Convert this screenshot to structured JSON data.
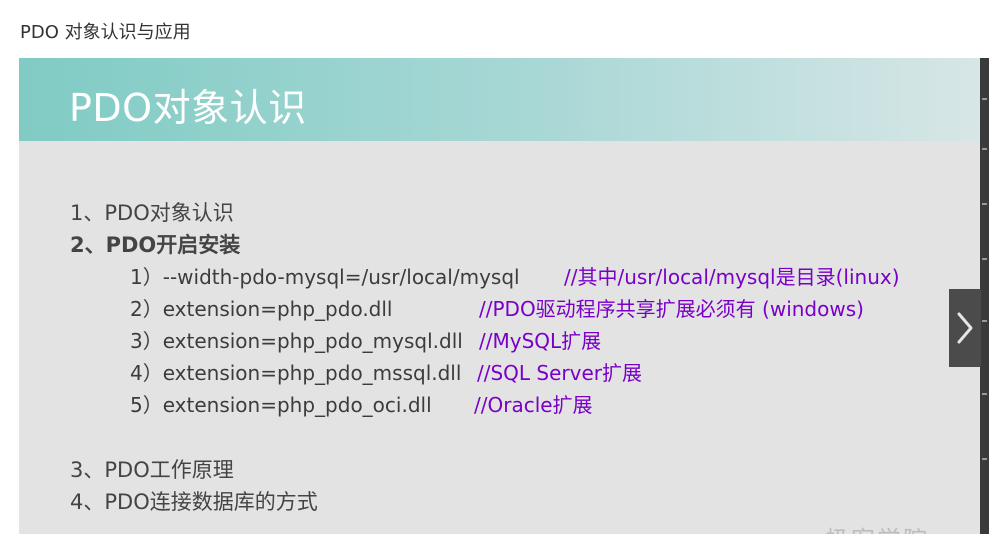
{
  "page": {
    "heading": "PDO 对象认识与应用"
  },
  "slide": {
    "title": "PDO对象认识",
    "items": [
      {
        "label": "1、PDO对象认识"
      },
      {
        "label": "2、PDO开启安装"
      },
      {
        "label": "3、PDO工作原理"
      },
      {
        "label": "4、PDO连接数据库的方式"
      }
    ],
    "sub_items": [
      {
        "code": "1）--width-pdo-mysql=/usr/local/mysql",
        "comment": "//其中/usr/local/mysql是目录(linux)"
      },
      {
        "code": "2）extension=php_pdo.dll",
        "comment": "//PDO驱动程序共享扩展必须有 (windows)"
      },
      {
        "code": "3）extension=php_pdo_mysql.dll",
        "comment": "//MySQL扩展"
      },
      {
        "code": "4）extension=php_pdo_mssql.dll",
        "comment": "//SQL Server扩展"
      },
      {
        "code": "5）extension=php_pdo_oci.dll",
        "comment": "//Oracle扩展"
      }
    ],
    "watermark": "极客学院"
  },
  "controls": {
    "next_icon": "chevron-right-icon"
  },
  "colors": {
    "banner_start": "#80cbc4",
    "banner_end": "#d7e6e6",
    "comment": "#7a00c8",
    "slide_bg": "#e3e3e3"
  }
}
